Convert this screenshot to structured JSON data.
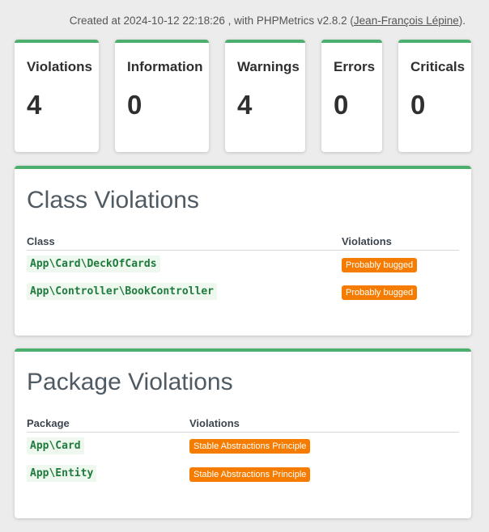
{
  "header": {
    "created_prefix": "Created at 2024-10-12 22:18:26 , with PHPMetrics v2.8.2 (",
    "author_link": "Jean-François Lépine",
    "created_suffix": ")."
  },
  "summary": [
    {
      "label": "Violations",
      "value": "4"
    },
    {
      "label": "Information",
      "value": "0"
    },
    {
      "label": "Warnings",
      "value": "4"
    },
    {
      "label": "Errors",
      "value": "0"
    },
    {
      "label": "Criticals",
      "value": "0"
    }
  ],
  "class_violations": {
    "title": "Class Violations",
    "columns": [
      "Class",
      "Violations"
    ],
    "rows": [
      {
        "name": "App\\Card\\DeckOfCards",
        "violation": "Probably bugged"
      },
      {
        "name": "App\\Controller\\BookController",
        "violation": "Probably bugged"
      }
    ]
  },
  "package_violations": {
    "title": "Package Violations",
    "columns": [
      "Package",
      "Violations"
    ],
    "rows": [
      {
        "name": "App\\Card",
        "violation": "Stable Abstractions Principle"
      },
      {
        "name": "App\\Entity",
        "violation": "Stable Abstractions Principle"
      }
    ]
  },
  "colors": {
    "accent": "#4caf6e",
    "badge": "#f57c00",
    "code_text": "#1f7a3d"
  }
}
